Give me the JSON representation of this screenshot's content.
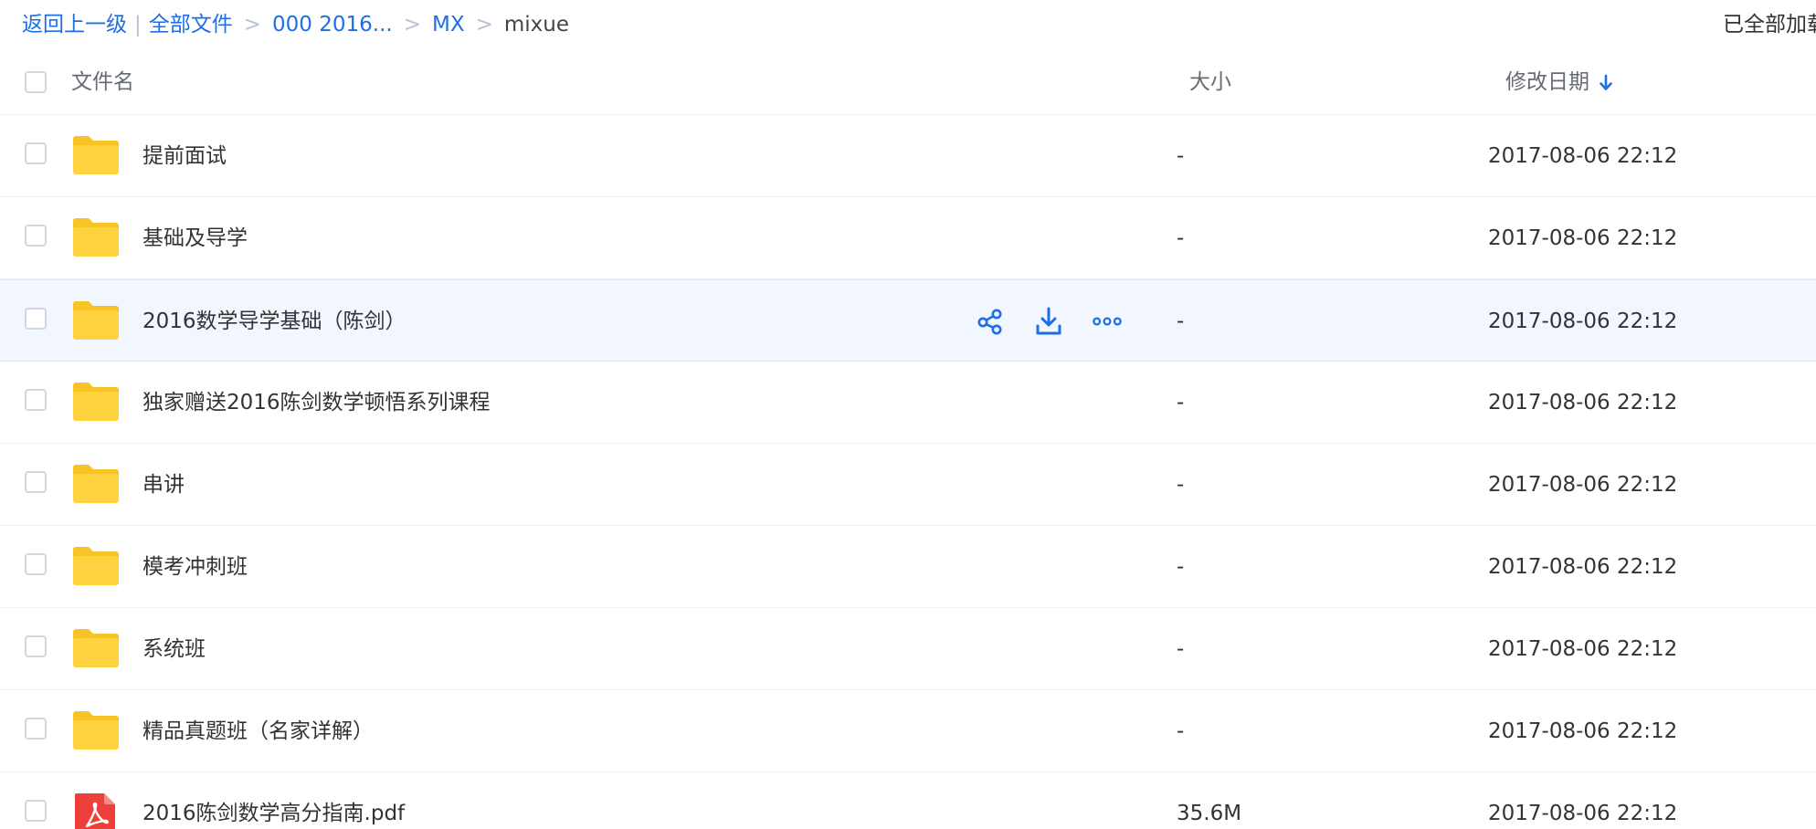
{
  "breadcrumb": {
    "back_label": "返回上一级",
    "all_files_label": "全部文件",
    "items": [
      "000 2016...",
      "MX"
    ],
    "current": "mixue",
    "separator": ">",
    "divider": "|"
  },
  "status": {
    "text": "已全部加载"
  },
  "table": {
    "headers": {
      "name": "文件名",
      "size": "大小",
      "date": "修改日期"
    },
    "sort": {
      "column": "date",
      "direction": "desc"
    },
    "rows": [
      {
        "name": "提前面试",
        "size": "-",
        "date": "2017-08-06 22:12",
        "type": "folder"
      },
      {
        "name": "基础及导学",
        "size": "-",
        "date": "2017-08-06 22:12",
        "type": "folder"
      },
      {
        "name": "2016数学导学基础（陈剑）",
        "size": "-",
        "date": "2017-08-06 22:12",
        "type": "folder",
        "hovered": true
      },
      {
        "name": "独家赠送2016陈剑数学顿悟系列课程",
        "size": "-",
        "date": "2017-08-06 22:12",
        "type": "folder"
      },
      {
        "name": "串讲",
        "size": "-",
        "date": "2017-08-06 22:12",
        "type": "folder"
      },
      {
        "name": "模考冲刺班",
        "size": "-",
        "date": "2017-08-06 22:12",
        "type": "folder"
      },
      {
        "name": "系统班",
        "size": "-",
        "date": "2017-08-06 22:12",
        "type": "folder"
      },
      {
        "name": "精品真题班（名家详解）",
        "size": "-",
        "date": "2017-08-06 22:12",
        "type": "folder"
      },
      {
        "name": "2016陈剑数学高分指南.pdf",
        "size": "35.6M",
        "date": "2017-08-06 22:12",
        "type": "pdf"
      }
    ]
  },
  "row_actions": [
    "share-icon",
    "download-icon",
    "more-icon"
  ],
  "colors": {
    "accent": "#1e6fe6",
    "folder": "#ffd23f",
    "folder_tab": "#f7c325",
    "pdf": "#ee3f3a",
    "hover_bg": "#f1f6ff"
  }
}
